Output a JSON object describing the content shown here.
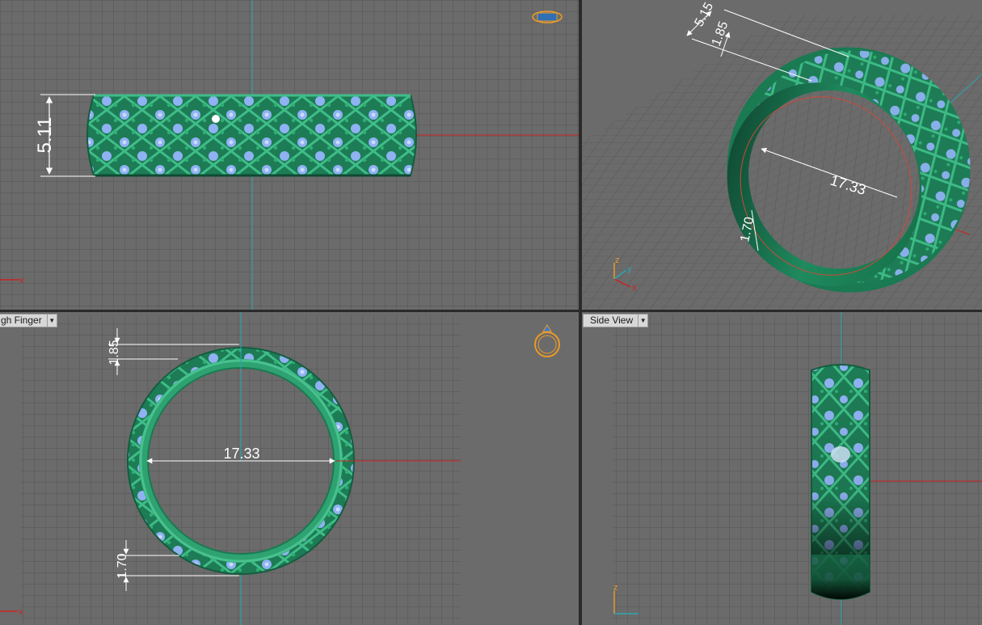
{
  "viewports": {
    "front": {
      "dimensions": {
        "height": "5.11"
      },
      "axes": {
        "x": "x"
      }
    },
    "perspective": {
      "dimensions": {
        "top_width": "5.15",
        "top_thickness": "1.85",
        "inner_diameter": "17.33",
        "side_thickness": "1.70"
      },
      "axes": {
        "x": "x",
        "y": "y",
        "z": "z"
      }
    },
    "finger": {
      "label": "gh Finger",
      "dimensions": {
        "top_thickness": "1.85",
        "inner_diameter": "17.33",
        "bottom_thickness": "1.70"
      },
      "axes": {
        "x": "x"
      }
    },
    "side": {
      "label": "Side View",
      "axes": {
        "z": "z"
      }
    }
  },
  "colors": {
    "viewport_bg": "#6b6b6b",
    "grid": "#5a5a5a",
    "ring_green": "#1f8a5e",
    "ring_light": "#3aa97a",
    "gem_blue": "#8fb2f2",
    "axis_red": "#cc2222",
    "axis_cyan": "#2aa7b0",
    "gizmo_orange": "#e89a2a"
  },
  "icons": {
    "front_gizmo": "ring-side-gizmo-icon",
    "finger_gizmo": "ring-front-gizmo-icon",
    "dropdown": "chevron-down-icon"
  }
}
